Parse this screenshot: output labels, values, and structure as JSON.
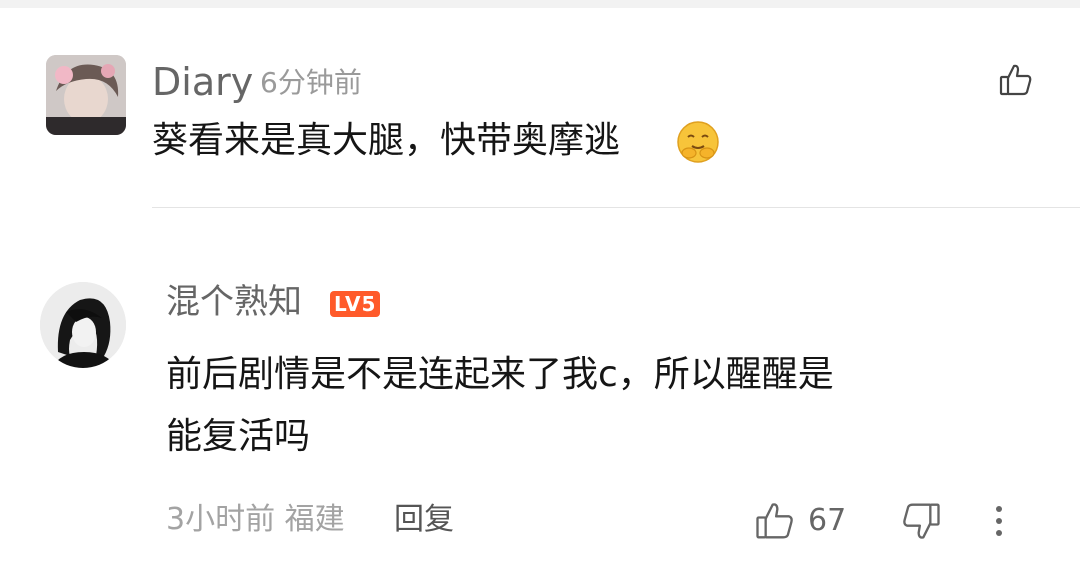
{
  "comments": [
    {
      "username": "Diary",
      "time": "6分钟前",
      "text": "葵看来是真大腿，快带奥摩逃",
      "emoji": "hugging-face-emoji"
    },
    {
      "username": "混个熟知",
      "level_badge": "LV5",
      "text_line1": "前后剧情是不是连起来了我c，所以醒醒是",
      "text_line2": "能复活吗",
      "meta": "3小时前 福建",
      "reply_label": "回复",
      "like_count": "67"
    }
  ],
  "colors": {
    "badge": "#ff5a2a",
    "text": "#151515",
    "secondary": "#9a9a9a"
  }
}
